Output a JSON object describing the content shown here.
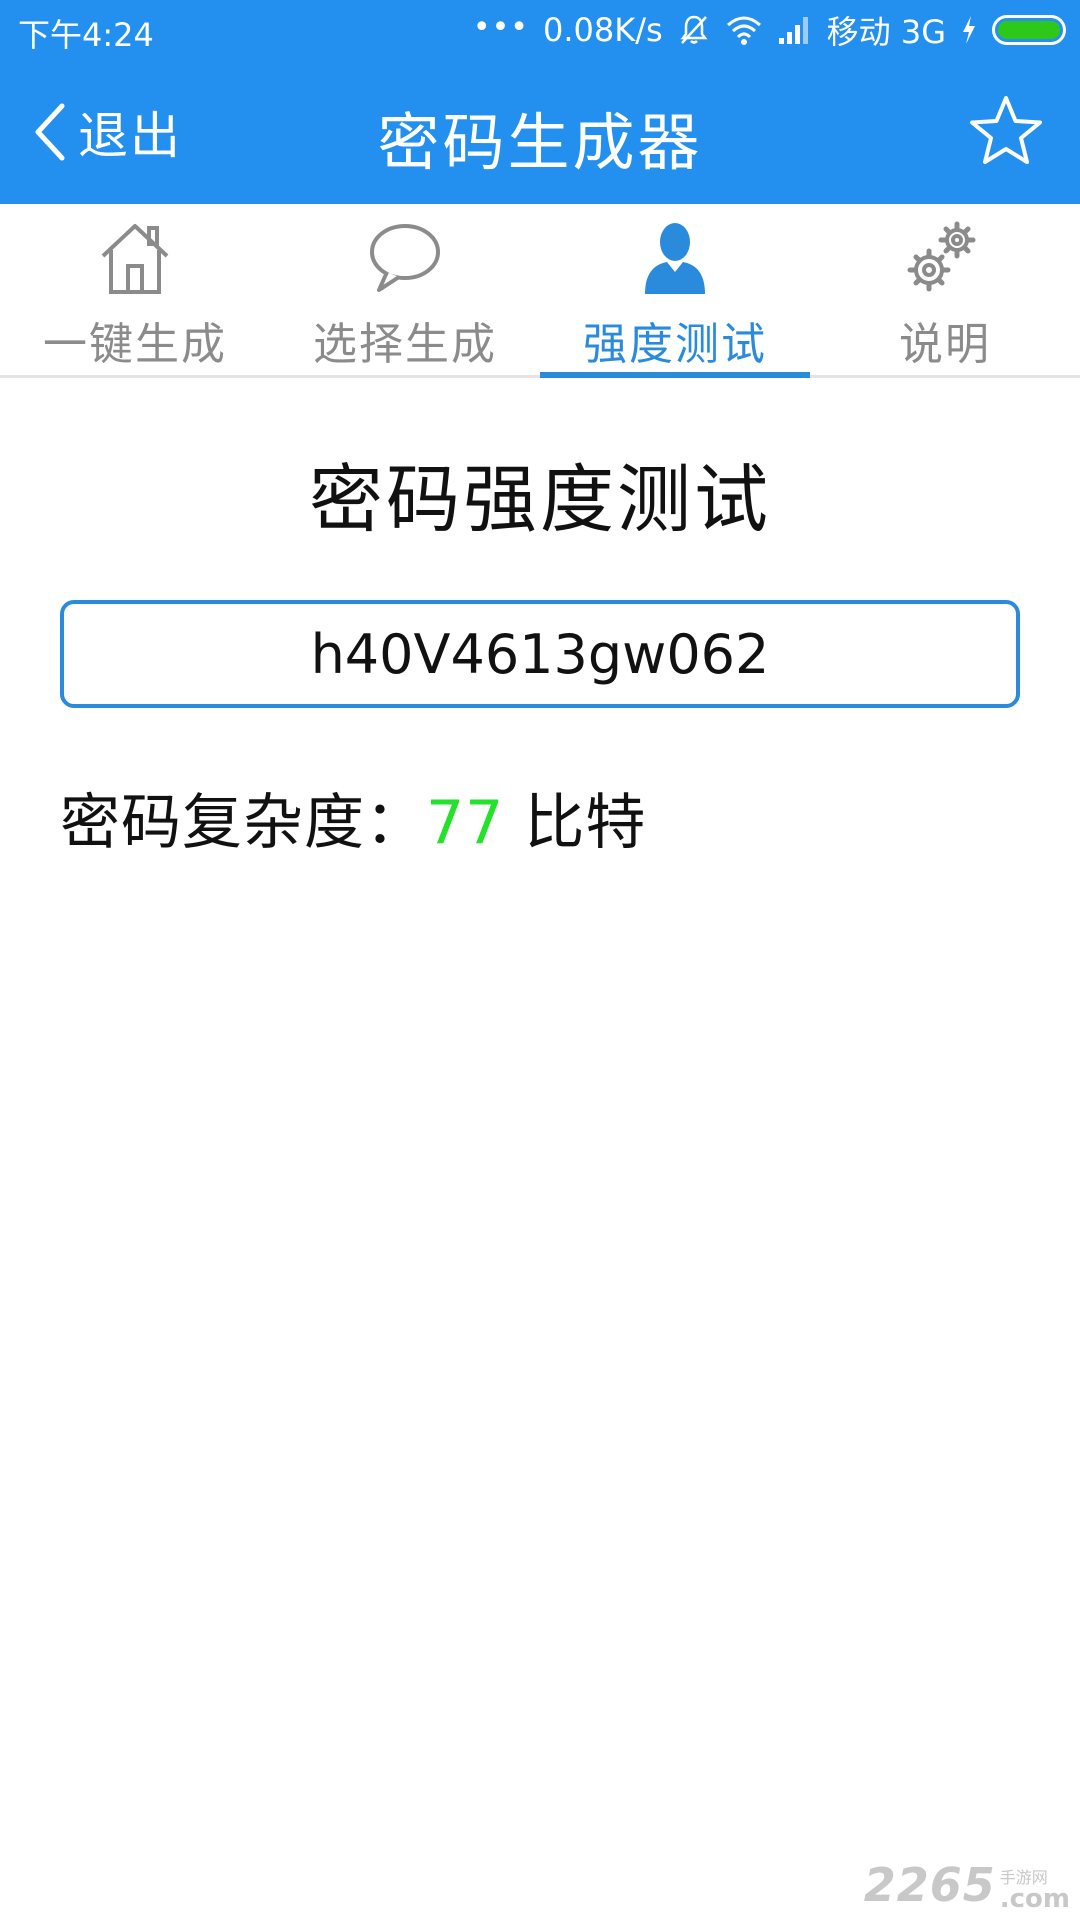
{
  "status_bar": {
    "time": "下午4:24",
    "dots": "•••",
    "network_speed": "0.08K/s",
    "carrier": "移动 3G",
    "icons": [
      "mute-bell-icon",
      "wifi-icon",
      "signal-icon",
      "charging-icon",
      "battery-icon"
    ],
    "battery_color": "#2ec81a"
  },
  "title_bar": {
    "back_label": "退出",
    "title": "密码生成器",
    "background_color": "#2390f0",
    "star_icon": "star-icon"
  },
  "tabs": [
    {
      "label": "一键生成",
      "icon": "home-icon",
      "active": false
    },
    {
      "label": "选择生成",
      "icon": "chat-bubble-icon",
      "active": false
    },
    {
      "label": "强度测试",
      "icon": "user-icon",
      "active": true
    },
    {
      "label": "说明",
      "icon": "gears-icon",
      "active": false
    }
  ],
  "main": {
    "section_title": "密码强度测试",
    "password_value": "h40V4613gw062",
    "complexity_label": "密码复杂度：",
    "complexity_value": "77",
    "complexity_unit": " 比特",
    "complexity_value_color": "#22e22a"
  },
  "watermark": {
    "main": "2265",
    "small": "手游网",
    "suffix": ".com"
  }
}
